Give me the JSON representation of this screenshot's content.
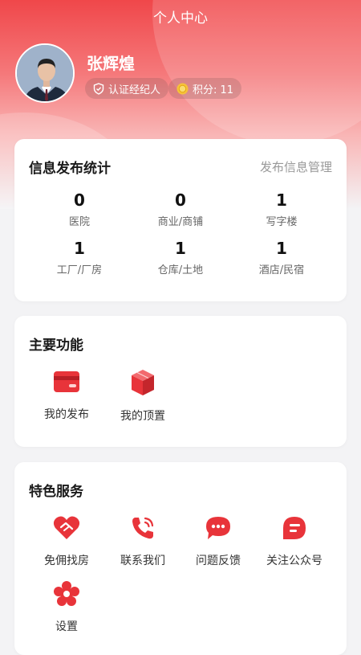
{
  "header": {
    "title": "个人中心"
  },
  "profile": {
    "name": "张辉煌",
    "verified_label": "认证经纪人",
    "points_label": "积分: 11"
  },
  "stats": {
    "title": "信息发布统计",
    "manage_link": "发布信息管理",
    "items": [
      {
        "value": "0",
        "label": "医院"
      },
      {
        "value": "0",
        "label": "商业/商铺"
      },
      {
        "value": "1",
        "label": "写字楼"
      },
      {
        "value": "1",
        "label": "工厂/厂房"
      },
      {
        "value": "1",
        "label": "仓库/土地"
      },
      {
        "value": "1",
        "label": "酒店/民宿"
      }
    ]
  },
  "main_functions": {
    "title": "主要功能",
    "items": [
      {
        "label": "我的发布",
        "icon": "wallet-icon"
      },
      {
        "label": "我的顶置",
        "icon": "cube-icon"
      }
    ]
  },
  "services": {
    "title": "特色服务",
    "items": [
      {
        "label": "免佣找房",
        "icon": "heart-handshake-icon"
      },
      {
        "label": "联系我们",
        "icon": "phone-icon"
      },
      {
        "label": "问题反馈",
        "icon": "chat-bubble-icon"
      },
      {
        "label": "关注公众号",
        "icon": "message-tag-icon"
      },
      {
        "label": "设置",
        "icon": "settings-flower-icon"
      }
    ]
  },
  "colors": {
    "accent": "#f0474a",
    "icon_red": "#e8343a"
  }
}
